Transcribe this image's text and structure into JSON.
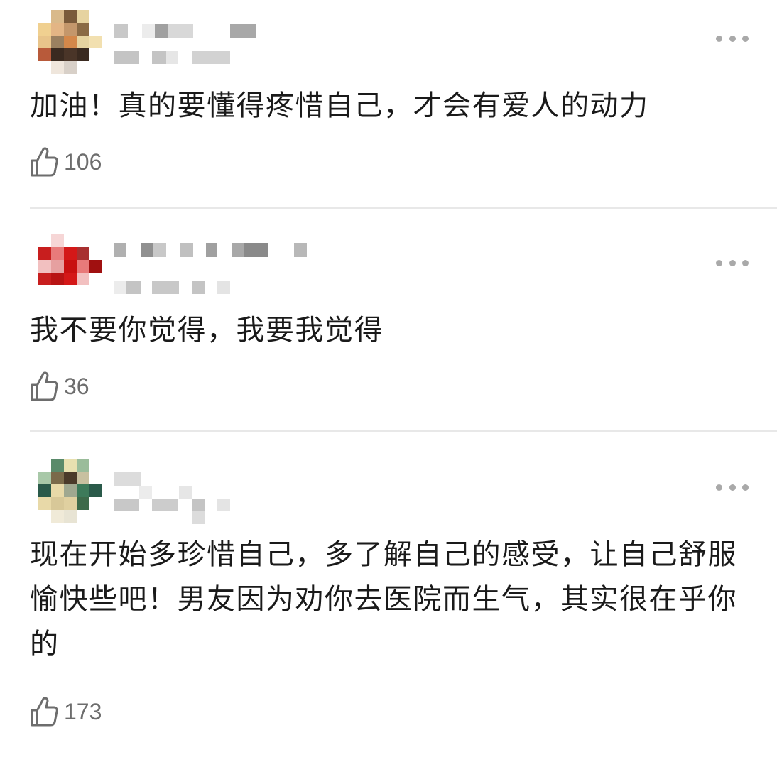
{
  "comments": [
    {
      "text": "加油！真的要懂得疼惜自己，才会有爱人的动力",
      "likes": "106",
      "avatar_colors": "#e8c48a,#7a5a3a,#c4976b,#e6d3a0,#b85a3a,#3a2a20"
    },
    {
      "text": "我不要你觉得，我要我觉得",
      "likes": "36",
      "avatar_colors": "#c81e1e,#e87a7a,#f2c0c0,#a01010,#ffffff"
    },
    {
      "text": "现在开始多珍惜自己，多了解自己的感受，让自己舒服愉快些吧！男友因为劝你去医院而生气，其实很在乎你的",
      "likes": "173",
      "avatar_colors": "#3d7a5a,#e8d9a8,#7a6a4a,#9abc9a,#2a5a4a"
    }
  ],
  "icons": {
    "like": "thumbs-up-icon",
    "more": "more-dots-icon"
  },
  "colors": {
    "text": "#1a1a1a",
    "muted": "#6d6d6d",
    "divider": "#e8e8e8",
    "dots": "#a9a9a9"
  }
}
